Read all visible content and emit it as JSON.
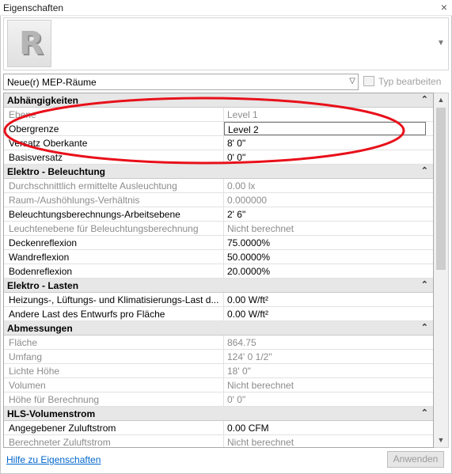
{
  "window": {
    "title": "Eigenschaften",
    "close_glyph": "×"
  },
  "preview": {
    "logo_letter": "R"
  },
  "type_selector": {
    "value": "Neue(r) MEP-Räume",
    "edit_type_label": "Typ bearbeiten"
  },
  "sections": [
    {
      "title": "Abhängigkeiten",
      "rows": [
        {
          "name": "Ebene",
          "value": "Level 1",
          "readonly": true
        },
        {
          "name": "Obergrenze",
          "value": "Level 2",
          "readonly": false,
          "active": true
        },
        {
          "name": "Versatz Oberkante",
          "value": "8'  0\"",
          "readonly": false
        },
        {
          "name": "Basisversatz",
          "value": "0'  0\"",
          "readonly": false
        }
      ]
    },
    {
      "title": "Elektro - Beleuchtung",
      "rows": [
        {
          "name": "Durchschnittlich ermittelte Ausleuchtung",
          "value": "0.00 lx",
          "readonly": true
        },
        {
          "name": "Raum-/Aushöhlungs-Verhältnis",
          "value": "0.000000",
          "readonly": true
        },
        {
          "name": "Beleuchtungsberechnungs-Arbeitsebene",
          "value": "2'  6\"",
          "readonly": false
        },
        {
          "name": "Leuchtenebene für Beleuchtungsberechnung",
          "value": "Nicht berechnet",
          "readonly": true
        },
        {
          "name": "Deckenreflexion",
          "value": "75.0000%",
          "readonly": false
        },
        {
          "name": "Wandreflexion",
          "value": "50.0000%",
          "readonly": false
        },
        {
          "name": "Bodenreflexion",
          "value": "20.0000%",
          "readonly": false
        }
      ]
    },
    {
      "title": "Elektro - Lasten",
      "rows": [
        {
          "name": "Heizungs-, Lüftungs- und Klimatisierungs-Last d...",
          "value": "0.00 W/ft²",
          "readonly": false
        },
        {
          "name": "Andere Last des Entwurfs pro Fläche",
          "value": "0.00 W/ft²",
          "readonly": false
        }
      ]
    },
    {
      "title": "Abmessungen",
      "rows": [
        {
          "name": "Fläche",
          "value": "864.75",
          "readonly": true
        },
        {
          "name": "Umfang",
          "value": "124'  0 1/2\"",
          "readonly": true
        },
        {
          "name": "Lichte Höhe",
          "value": "18'  0\"",
          "readonly": true
        },
        {
          "name": "Volumen",
          "value": "Nicht berechnet",
          "readonly": true
        },
        {
          "name": "Höhe für Berechnung",
          "value": "0'  0\"",
          "readonly": true
        }
      ]
    },
    {
      "title": "HLS-Volumenstrom",
      "rows": [
        {
          "name": "Angegebener Zuluftstrom",
          "value": "0.00 CFM",
          "readonly": false
        },
        {
          "name": "Berechneter Zuluftstrom",
          "value": "Nicht berechnet",
          "readonly": true
        }
      ]
    }
  ],
  "collapse_glyph": "⌃",
  "footer": {
    "help_link": "Hilfe zu Eigenschaften",
    "apply_label": "Anwenden"
  },
  "annotation": {
    "color": "#e8101a"
  }
}
